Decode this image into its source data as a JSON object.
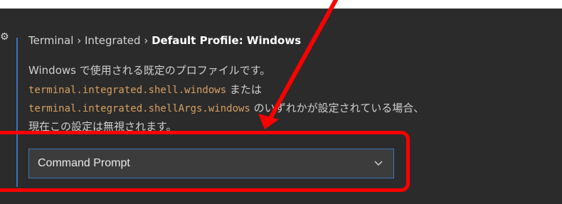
{
  "setting": {
    "breadcrumb_1": "Terminal",
    "breadcrumb_2": "Integrated",
    "setting_name": "Default Profile: Windows",
    "separator": "›",
    "description_line1": "Windows で使用される既定のプロファイルです。",
    "code1": "terminal.integrated.shell.windows",
    "text_mataha": " または",
    "code2": "terminal.integrated.shellArgs.windows",
    "text_line3_tail": " のいずれかが設定されている場合、",
    "description_line4": "現在この設定は無視されます。"
  },
  "dropdown": {
    "value": "Command Prompt"
  },
  "annotations": {
    "arrow_color": "#ff0000",
    "box_color": "#ff0000"
  },
  "colors": {
    "background": "#2b2b2b",
    "accent": "#3a76b5",
    "code": "#d7a062"
  }
}
